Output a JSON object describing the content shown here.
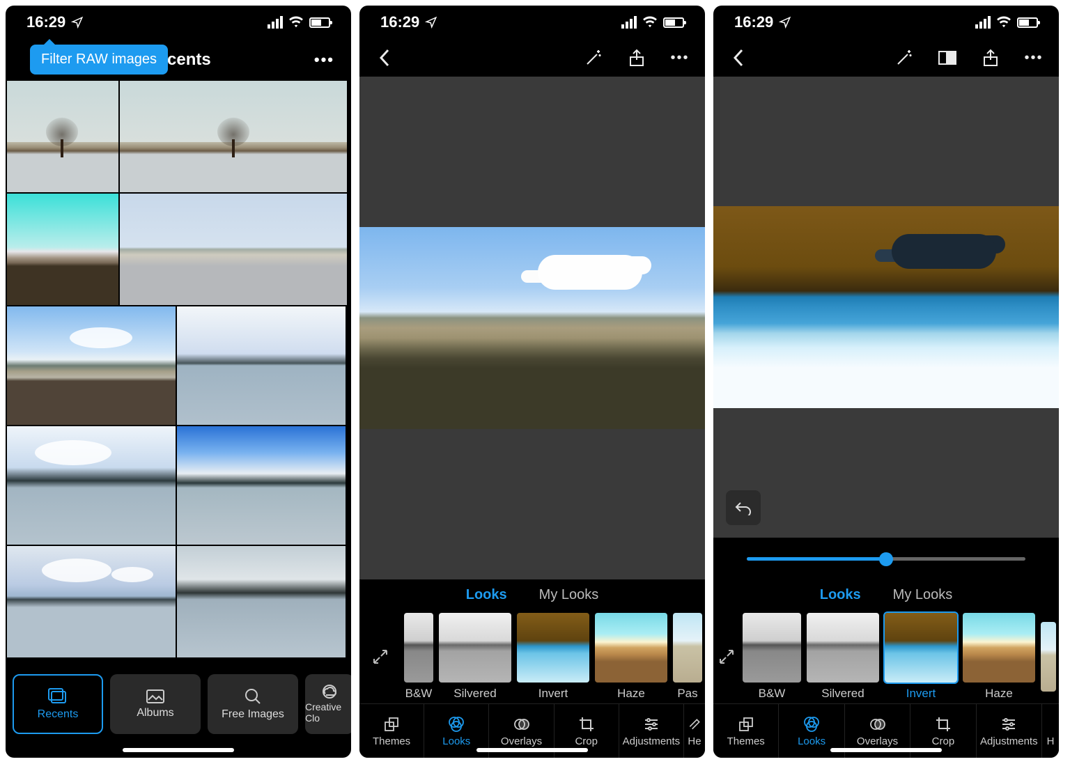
{
  "status": {
    "time": "16:29"
  },
  "screen1": {
    "tooltip": "Filter RAW images",
    "title": "Recents",
    "nav": {
      "recents": "Recents",
      "albums": "Albums",
      "free": "Free Images",
      "cc": "Creative Clo"
    }
  },
  "editor": {
    "tabs": {
      "looks": "Looks",
      "mylooks": "My Looks"
    },
    "looks": {
      "bw": "B&W",
      "silvered": "Silvered",
      "invert": "Invert",
      "haze": "Haze",
      "pastel": "Pas"
    },
    "tools": {
      "themes": "Themes",
      "looks": "Looks",
      "overlays": "Overlays",
      "crop": "Crop",
      "adjustments": "Adjustments",
      "heal": "He",
      "heal2": "H"
    },
    "slider_pct": 50
  }
}
